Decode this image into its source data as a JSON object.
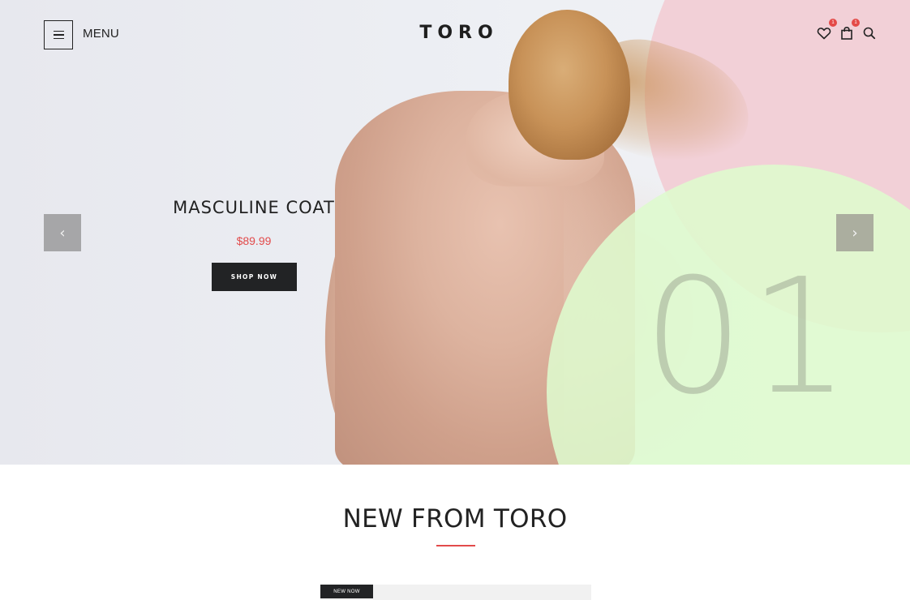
{
  "header": {
    "menu_label": "MENU",
    "logo": "TORO",
    "wishlist_count": "1",
    "cart_count": "1"
  },
  "hero": {
    "title": "MASCULINE COAT",
    "price": "$89.99",
    "cta_label": "SHOP NOW",
    "slide_number": "01",
    "prev_arrow": "‹",
    "next_arrow": "›"
  },
  "section": {
    "title": "NEW FROM TORO"
  },
  "product": {
    "tag": "NEW NOW"
  },
  "colors": {
    "accent": "#e24b4b",
    "dark": "#222325",
    "blob_pink": "#f2c8d0",
    "blob_green": "#deface"
  },
  "icons": [
    "menu-icon",
    "heart-icon",
    "shopping-bag-icon",
    "search-icon",
    "chevron-left-icon",
    "chevron-right-icon"
  ]
}
